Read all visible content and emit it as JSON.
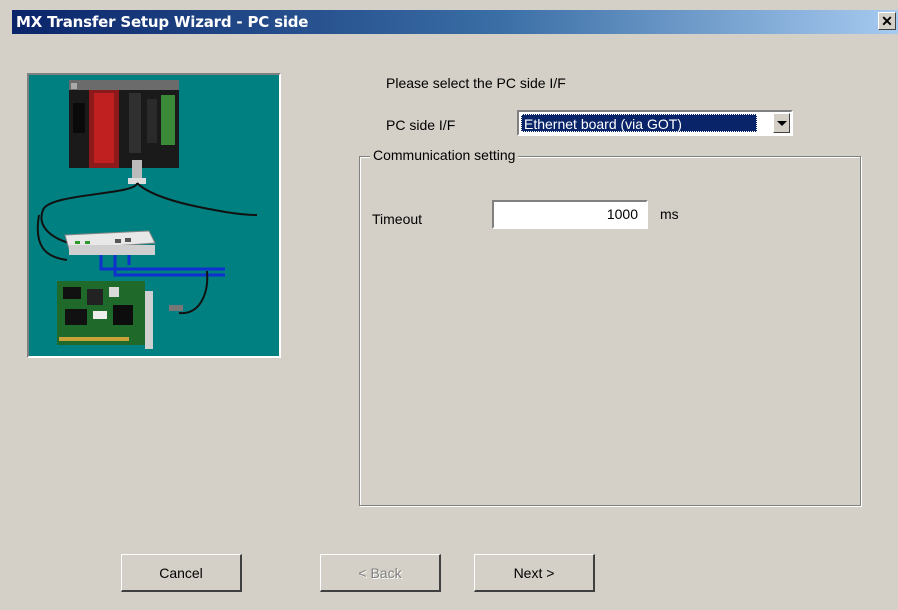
{
  "window": {
    "title": "MX Transfer Setup Wizard - PC side",
    "close_glyph": "✕"
  },
  "main": {
    "prompt": "Please select the PC side I/F",
    "pc_side_if_label": "PC side I/F",
    "pc_side_if_value": "Ethernet board (via GOT)"
  },
  "communication": {
    "group_label": "Communication setting",
    "timeout_label": "Timeout",
    "timeout_value": "1000",
    "timeout_unit": "ms"
  },
  "buttons": {
    "cancel": "Cancel",
    "back": "< Back",
    "next": "Next >"
  },
  "colors": {
    "title_bar": "#0a246a",
    "dialog_bg": "#d4d0c8",
    "illustration_bg": "#008080",
    "selection": "#0a246a"
  }
}
